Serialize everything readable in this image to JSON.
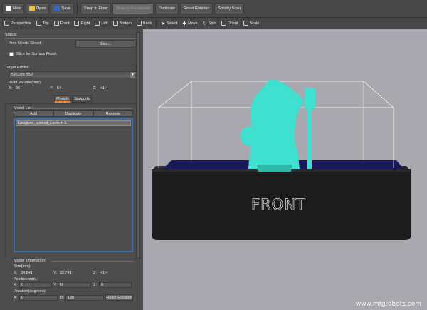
{
  "toolbar": {
    "new": "New",
    "open": "Open",
    "save": "Save",
    "snap_to_floor": "Snap to Floor",
    "snap_to_foundation": "Snap to Foundation",
    "duplicate": "Duplicate",
    "reset_rotation": "Reset Rotation",
    "solidify_scan": "Solidify Scan"
  },
  "view_toolbar": {
    "perspective": "Perspective",
    "top": "Top",
    "front": "Front",
    "right": "Right",
    "left": "Left",
    "bottom": "Bottom",
    "back": "Back",
    "select": "Select",
    "move": "Move",
    "spin": "Spin",
    "orient": "Orient",
    "scale": "Scale"
  },
  "panel": {
    "status_label": "Status:",
    "print_needs_sliced": "Print Needs Sliced:",
    "slice_button": "Slice...",
    "slice_surface_finish": "Slice for Surface Finish",
    "target_printer_label": "Target Printer:",
    "target_printer_value": "B9 Core 550",
    "build_volume_label": "Build Volume(mm):",
    "build_volume": {
      "x_label": "X:",
      "x": "96",
      "y_label": "Y:",
      "y": "54",
      "z_label": "Z:",
      "z": "41.4"
    },
    "tabs": {
      "models": "Models",
      "supports": "Supports"
    },
    "model_list_label": "Model List:",
    "add": "Add",
    "duplicate": "Duplicate",
    "remove": "Remove",
    "models": [
      "Lawgiver_special_Lantern 1"
    ],
    "model_info_label": "Model Information:",
    "size_label": "Size(mm):",
    "size": {
      "x_label": "X:",
      "x": "34.841",
      "y_label": "Y:",
      "y": "32.741",
      "z_label": "Z:",
      "z": "41.4"
    },
    "position_label": "Position(mm):",
    "position": {
      "x_label": "X:",
      "x": "0",
      "y_label": "Y:",
      "y": "0",
      "z_label": "Z:",
      "z": "0"
    },
    "rotation_label": "Rotation(degrees):",
    "rotation": {
      "a_label": "A:",
      "a": "0",
      "b_label": "B:",
      "b": "180"
    },
    "reset_rotation": "Reset Rotation"
  },
  "viewport": {
    "base_label": "FRONT",
    "watermark": "www.mfgrobots.com"
  },
  "colors": {
    "model": "#3fe0d0",
    "accent_tab": "#e8812c",
    "selection_blue": "#3a6ea8",
    "printer_body": "#1c1c1c",
    "build_plate": "#1a1a5a"
  }
}
